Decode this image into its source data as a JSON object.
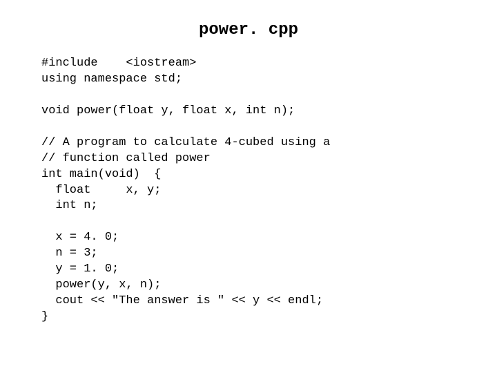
{
  "title": "power. cpp",
  "code": "#include    <iostream>\nusing namespace std;\n\nvoid power(float y, float x, int n);\n\n// A program to calculate 4-cubed using a\n// function called power\nint main(void)  {\n  float     x, y;\n  int n;\n\n  x = 4. 0;\n  n = 3;\n  y = 1. 0;\n  power(y, x, n);\n  cout << \"The answer is \" << y << endl;\n}"
}
